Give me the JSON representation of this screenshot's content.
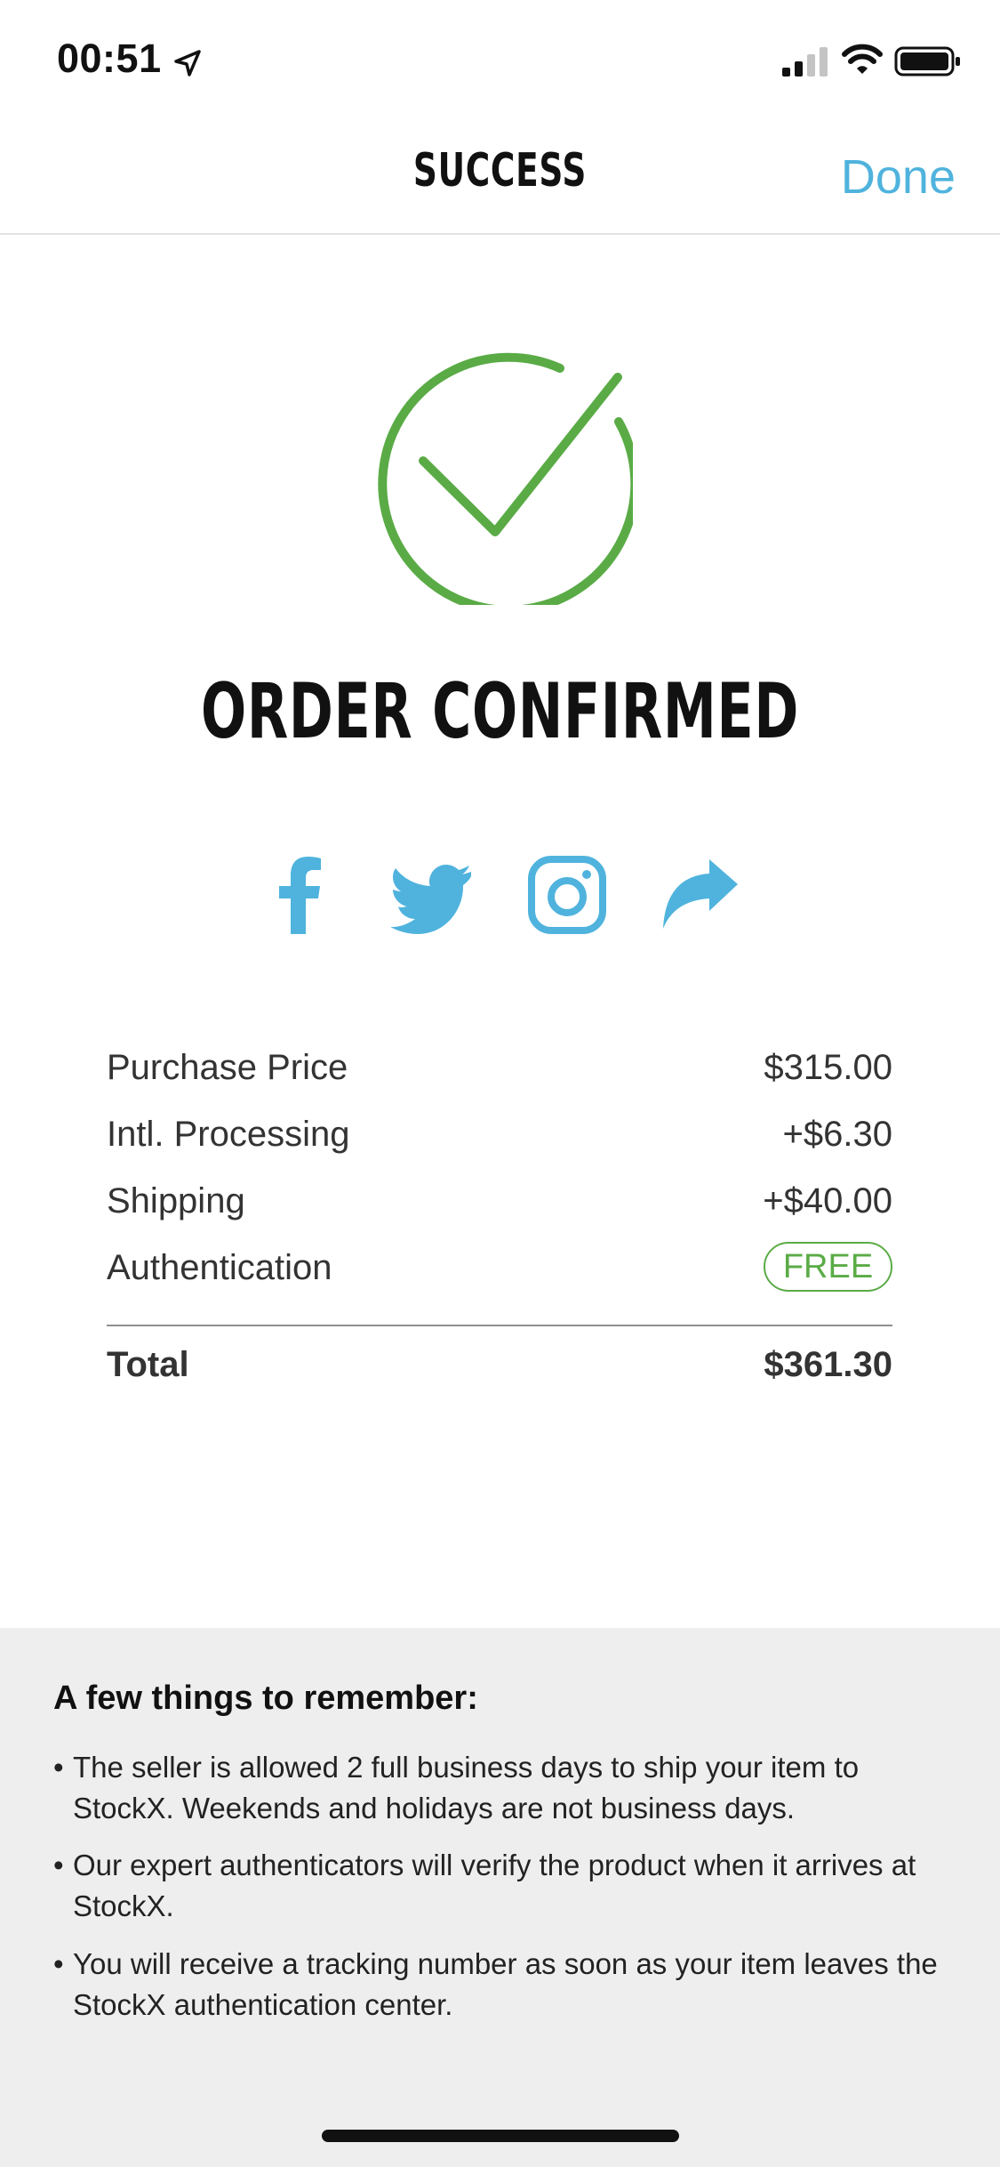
{
  "status_bar": {
    "time": "00:51"
  },
  "nav": {
    "title": "SUCCESS",
    "done_label": "Done"
  },
  "confirmation": {
    "title": "ORDER CONFIRMED"
  },
  "social": [
    {
      "icon": "facebook-icon"
    },
    {
      "icon": "twitter-icon"
    },
    {
      "icon": "instagram-icon"
    },
    {
      "icon": "share-icon"
    }
  ],
  "colors": {
    "accent": "#4fb3dd",
    "success": "#5aab46",
    "info_panel_bg": "#eeeeee"
  },
  "pricing": {
    "rows": [
      {
        "label": "Purchase Price",
        "value": "$315.00"
      },
      {
        "label": "Intl. Processing",
        "value": "+$6.30"
      },
      {
        "label": "Shipping",
        "value": "+$40.00"
      },
      {
        "label": "Authentication",
        "value": "FREE"
      }
    ],
    "total_label": "Total",
    "total_value": "$361.30"
  },
  "info": {
    "heading": "A few things to remember:",
    "bullet": "•",
    "items": [
      "The seller is allowed 2 full business days to ship your item to StockX. Weekends and holidays are not business days.",
      "Our expert authenticators will verify the product when it arrives at StockX.",
      "You will receive a tracking number as soon as your item leaves the StockX authentication center."
    ]
  }
}
